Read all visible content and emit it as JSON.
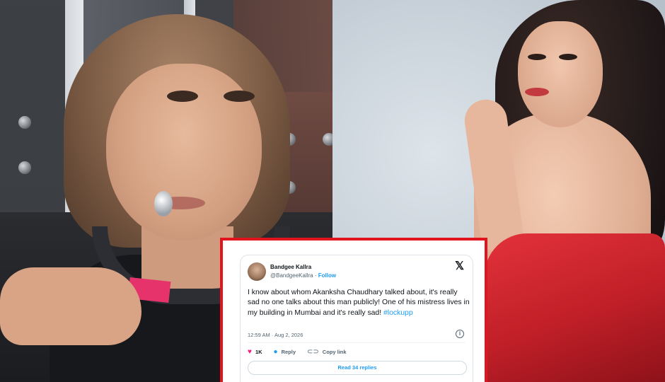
{
  "tweet": {
    "display_name": "Bandgee Kallra",
    "handle": "@BandgeeKallra",
    "separator": "·",
    "follow_label": "Follow",
    "x_logo": "𝕏",
    "text_main": "I know about whom Akanksha Chaudhary talked about, it's really sad no one talks about this man publicly! One of his mistress lives in my building in Mumbai and it's really sad!",
    "hashtag": "#lockupp",
    "timestamp": "12:59 AM · Aug 2, 2026",
    "info_glyph": "i",
    "like_count": "1K",
    "reply_label": "Reply",
    "copy_link_label": "Copy link",
    "read_replies_label": "Read 34 replies",
    "icons": {
      "heart": "heart-icon",
      "reply": "reply-bubble-icon",
      "link": "link-icon",
      "x_logo": "x-logo-icon",
      "info": "info-icon"
    }
  },
  "colors": {
    "frame_border": "#e0151d",
    "link_blue": "#1d9bf0",
    "heart_pink": "#f91880",
    "dress_red": "#c01f28"
  }
}
